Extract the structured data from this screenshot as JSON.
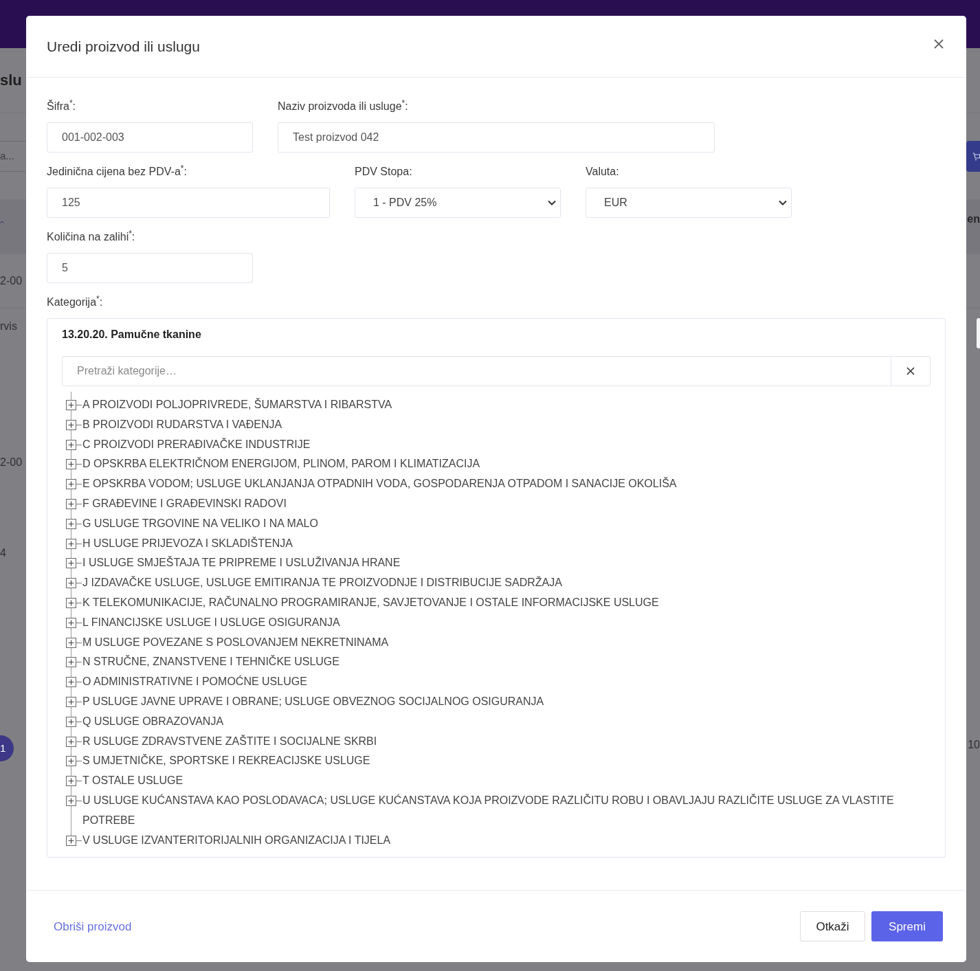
{
  "background": {
    "page_title": "slu",
    "search": {
      "placeholder": "a..."
    },
    "left_cells": [
      "2-00",
      "rvis",
      "2-00",
      "4"
    ],
    "pagination_page": "1",
    "right_header": "en",
    "right_cell": "10"
  },
  "modal": {
    "title": "Uredi proizvod ili uslugu",
    "form_rows": [
      [
        {
          "kind": "input",
          "label": "Šifra$^{*}$:",
          "value": "001-002-003"
        },
        {
          "kind": "input",
          "label": "Naziv proizvoda ili usluge$^{*}$:",
          "value": "Test proizvod 042"
        }
      ],
      [
        {
          "kind": "input",
          "label": "Jedinična cijena bez PDV-a$^{*}$:",
          "value": "125"
        },
        {
          "kind": "select",
          "label": "PDV Stopa:",
          "value": "1 - PDV 25%"
        },
        {
          "kind": "select",
          "label": "Valuta:",
          "value": "EUR"
        }
      ],
      [
        {
          "kind": "input",
          "label": "Količina na zalihi$^{*}$:",
          "value": "5"
        }
      ]
    ],
    "category": {
      "label": "Kategorija$^{*}$:",
      "selected_value": "13.20.20. Pamučne tkanine",
      "search": {
        "placeholder": "Pretraži kategorije…"
      },
      "tree": [
        {
          "label": "A PROIZVODI POLJOPRIVREDE, ŠUMARSTVA I RIBARSTVA",
          "expanded": false
        },
        {
          "label": "B PROIZVODI RUDARSTVA I VAĐENJA",
          "expanded": false
        },
        {
          "label": "C PROIZVODI PRERAĐIVAČKE INDUSTRIJE",
          "expanded": false
        },
        {
          "label": "D OPSKRBA ELEKTRIČNOM ENERGIJOM, PLINOM, PAROM I KLIMATIZACIJA",
          "expanded": false
        },
        {
          "label": "E OPSKRBA VODOM; USLUGE UKLANJANJA OTPADNIH VODA, GOSPODARENJA OTPADOM I SANACIJE OKOLIŠA",
          "expanded": false
        },
        {
          "label": "F GRAĐEVINE I GRAĐEVINSKI RADOVI",
          "expanded": false
        },
        {
          "label": "G USLUGE TRGOVINE NA VELIKO I NA MALO",
          "expanded": false
        },
        {
          "label": "H USLUGE PRIJEVOZA I SKLADIŠTENJA",
          "expanded": false
        },
        {
          "label": "I USLUGE SMJEŠTAJA TE PRIPREME I USLUŽIVANJA HRANE",
          "expanded": false
        },
        {
          "label": "J IZDAVAČKE USLUGE, USLUGE EMITIRANJA TE PROIZVODNJE I DISTRIBUCIJE SADRŽAJA",
          "expanded": false
        },
        {
          "label": "K TELEKOMUNIKACIJE, RAČUNALNO PROGRAMIRANJE, SAVJETOVANJE I OSTALE INFORMACIJSKE USLUGE",
          "expanded": false
        },
        {
          "label": "L FINANCIJSKE USLUGE I USLUGE OSIGURANJA",
          "expanded": false
        },
        {
          "label": "M USLUGE POVEZANE S POSLOVANJEM NEKRETNINAMA",
          "expanded": false
        },
        {
          "label": "N STRUČNE, ZNANSTVENE I TEHNIČKE USLUGE",
          "expanded": false
        },
        {
          "label": "O ADMINISTRATIVNE I POMOĆNE USLUGE",
          "expanded": false
        },
        {
          "label": "P USLUGE JAVNE UPRAVE I OBRANE; USLUGE OBVEZNOG SOCIJALNOG OSIGURANJA",
          "expanded": false
        },
        {
          "label": "Q USLUGE OBRAZOVANJA",
          "expanded": false
        },
        {
          "label": "R USLUGE ZDRAVSTVENE ZAŠTITE I SOCIJALNE SKRBI",
          "expanded": false
        },
        {
          "label": "S UMJETNIČKE, SPORTSKE I REKREACIJSKE USLUGE",
          "expanded": false
        },
        {
          "label": "T OSTALE USLUGE",
          "expanded": false
        },
        {
          "label": "U USLUGE KUĆANSTAVA KAO POSLODAVACA; USLUGE KUĆANSTAVA KOJA PROIZVODE RAZLIČITU ROBU I OBAVLJAJU RAZLIČITE USLUGE ZA VLASTITE POTREBE",
          "expanded": false
        },
        {
          "label": "V USLUGE IZVANTERITORIJALNIH ORGANIZACIJA I TIJELA",
          "expanded": false
        }
      ]
    },
    "footer": {
      "delete_link": "Obriši proizvod",
      "buttons": [
        {
          "kind": "secondary",
          "label": "Otkaži"
        },
        {
          "kind": "primary",
          "label": "Spremi"
        }
      ]
    }
  }
}
